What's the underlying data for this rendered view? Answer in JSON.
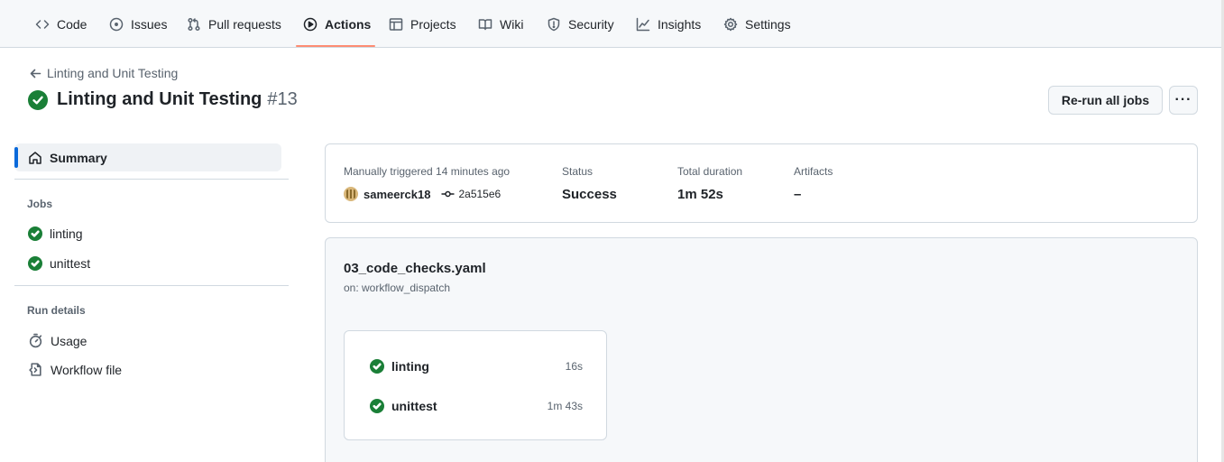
{
  "nav": {
    "tabs": [
      {
        "label": "Code",
        "icon": "code-icon"
      },
      {
        "label": "Issues",
        "icon": "issue-icon"
      },
      {
        "label": "Pull requests",
        "icon": "pull-request-icon"
      },
      {
        "label": "Actions",
        "icon": "play-icon",
        "active": true
      },
      {
        "label": "Projects",
        "icon": "table-icon"
      },
      {
        "label": "Wiki",
        "icon": "book-icon"
      },
      {
        "label": "Security",
        "icon": "shield-icon"
      },
      {
        "label": "Insights",
        "icon": "graph-icon"
      },
      {
        "label": "Settings",
        "icon": "gear-icon"
      }
    ],
    "active_color": "#fd8c73"
  },
  "header": {
    "back_label": "Linting and Unit Testing",
    "title": "Linting and Unit Testing",
    "run_number": "#13",
    "rerun_label": "Re-run all jobs",
    "more_label": "···"
  },
  "sidebar": {
    "summary_label": "Summary",
    "jobs_heading": "Jobs",
    "jobs": [
      {
        "label": "linting",
        "status": "success"
      },
      {
        "label": "unittest",
        "status": "success"
      }
    ],
    "details_heading": "Run details",
    "details": [
      {
        "label": "Usage",
        "icon": "stopwatch-icon"
      },
      {
        "label": "Workflow file",
        "icon": "file-code-icon"
      }
    ]
  },
  "summary": {
    "trigger_label": "Manually triggered 14 minutes ago",
    "actor": "sameerck18",
    "commit": "2a515e6",
    "status_label": "Status",
    "status_value": "Success",
    "duration_label": "Total duration",
    "duration_value": "1m 52s",
    "artifacts_label": "Artifacts",
    "artifacts_value": "–"
  },
  "workflow": {
    "file": "03_code_checks.yaml",
    "trigger": "on: workflow_dispatch",
    "jobs": [
      {
        "name": "linting",
        "duration": "16s",
        "status": "success"
      },
      {
        "name": "unittest",
        "duration": "1m 43s",
        "status": "success"
      }
    ]
  },
  "colors": {
    "success": "#1a7f37",
    "accent_blue": "#0969da"
  }
}
